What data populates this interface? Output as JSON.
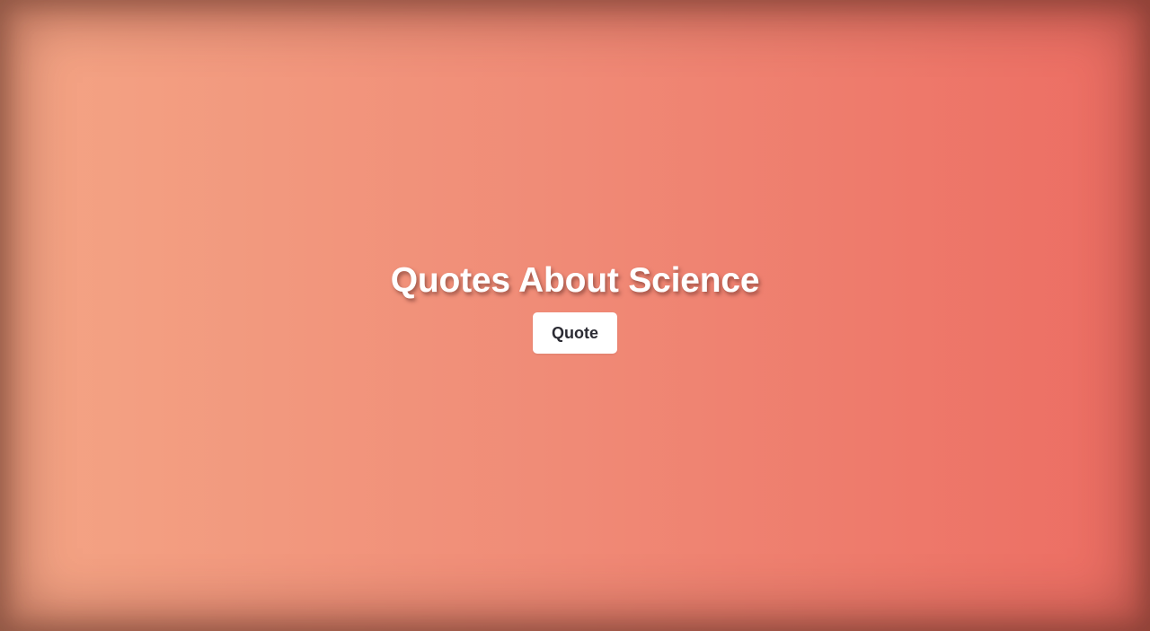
{
  "page": {
    "title": "Quotes About Science"
  },
  "actions": {
    "quote_label": "Quote"
  },
  "colors": {
    "gradient_left": "#f4a585",
    "gradient_mid": "#f08a76",
    "gradient_right": "#ec6c62",
    "title_text": "#ffffff",
    "button_bg": "#ffffff",
    "button_text": "#2b2b33"
  }
}
